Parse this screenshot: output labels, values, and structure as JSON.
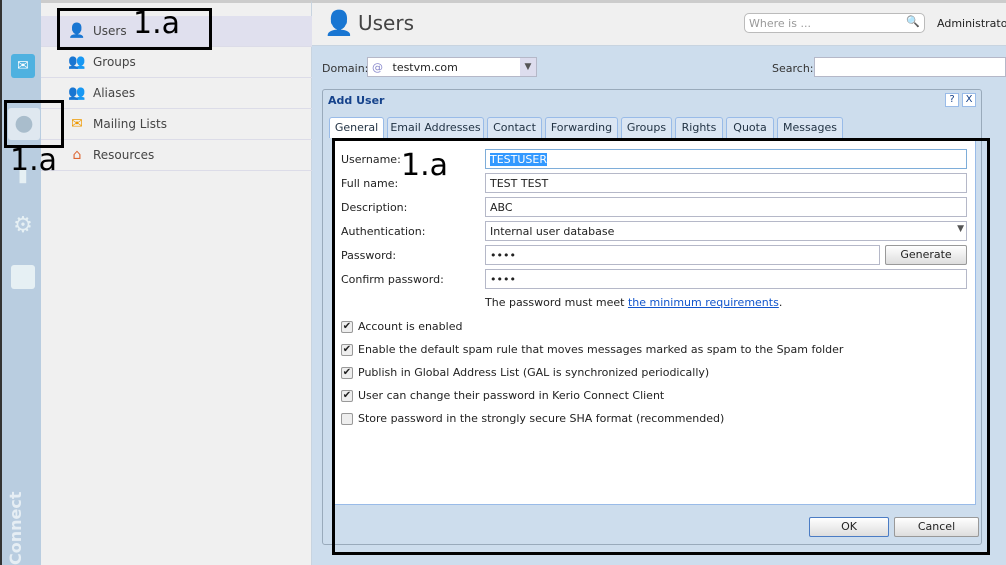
{
  "rail": {
    "brand": "Connect",
    "icons": [
      "mail-icon",
      "users-icon",
      "stats-icon",
      "gear-icon",
      "log-icon"
    ]
  },
  "nav": {
    "items": [
      {
        "label": "Users",
        "icon": "user-icon",
        "selected": true
      },
      {
        "label": "Groups",
        "icon": "groups-icon"
      },
      {
        "label": "Aliases",
        "icon": "aliases-icon"
      },
      {
        "label": "Mailing Lists",
        "icon": "mailing-lists-icon"
      },
      {
        "label": "Resources",
        "icon": "house-icon"
      }
    ]
  },
  "header": {
    "title": "Users",
    "search_placeholder": "Where is ...",
    "user": "Administrator"
  },
  "toolbar": {
    "domain_label": "Domain:",
    "domain_value": "testvm.com",
    "search_label": "Search:"
  },
  "dialog": {
    "title": "Add User",
    "help": "?",
    "close": "X",
    "tabs": [
      "General",
      "Email Addresses",
      "Contact",
      "Forwarding",
      "Groups",
      "Rights",
      "Quota",
      "Messages"
    ],
    "fields": {
      "username_label": "Username:",
      "username": "TESTUSER",
      "fullname_label": "Full name:",
      "fullname": "TEST TEST",
      "description_label": "Description:",
      "description": "ABC",
      "auth_label": "Authentication:",
      "auth": "Internal user database",
      "password_label": "Password:",
      "password": "••••",
      "confirm_label": "Confirm password:",
      "confirm": "••••",
      "generate": "Generate",
      "hint_prefix": "The password must meet ",
      "hint_link": "the minimum requirements",
      "hint_suffix": "."
    },
    "checkboxes": [
      {
        "label": "Account is enabled",
        "checked": true
      },
      {
        "label": "Enable the default spam rule that moves messages marked as spam to the Spam folder",
        "checked": true
      },
      {
        "label": "Publish in Global Address List (GAL is synchronized periodically)",
        "checked": true
      },
      {
        "label": "User can change their password in Kerio Connect Client",
        "checked": true
      },
      {
        "label": "Store password in the strongly secure SHA format (recommended)",
        "checked": false
      }
    ],
    "ok": "OK",
    "cancel": "Cancel"
  },
  "annotations": [
    "1.a",
    "1.a",
    "1.a"
  ]
}
